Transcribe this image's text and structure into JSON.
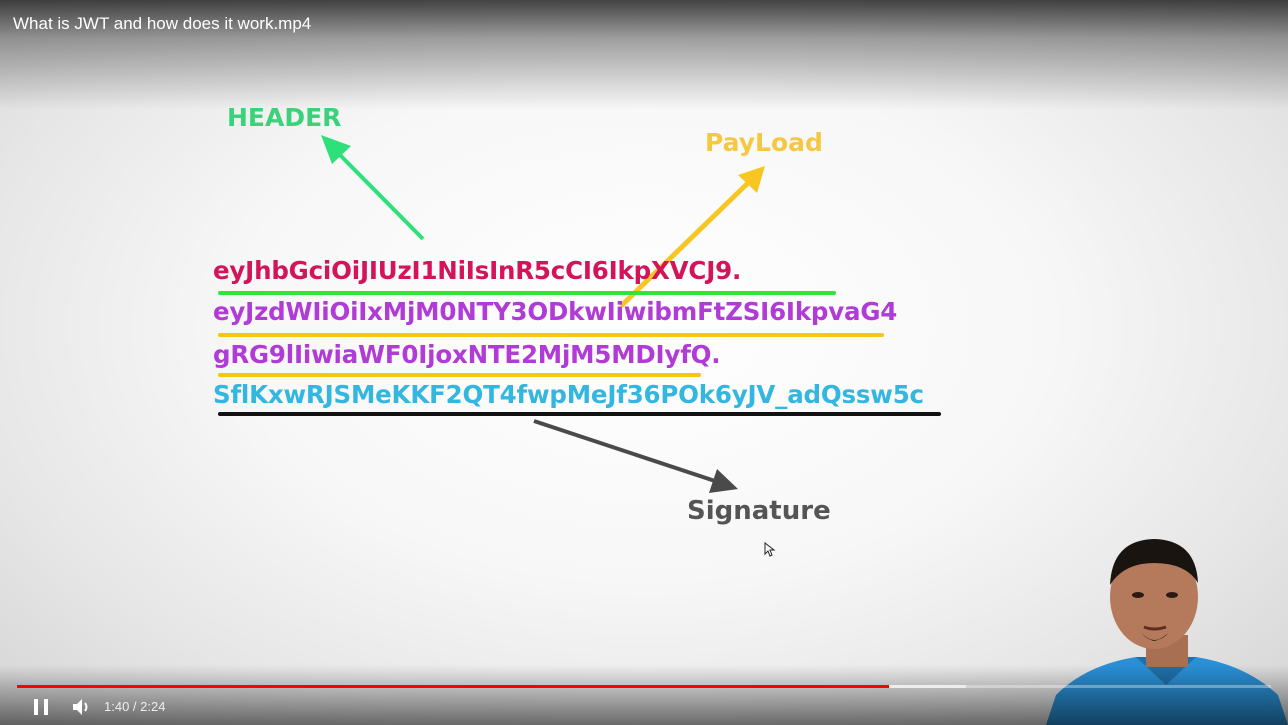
{
  "video": {
    "title": "What is JWT and how does it work.mp4"
  },
  "slide": {
    "header_label": "HEADER",
    "payload_label": "PayLoad",
    "signature_label": "Signature",
    "jwt_lines": [
      "eyJhbGciOiJIUzI1NiIsInR5cCI6IkpXVCJ9.",
      "eyJzdWIiOiIxMjM0NTY3ODkwIiwibmFtZSI6IkpvaG4",
      "gRG9lIiwiaWF0IjoxNTE2MjM5MDIyfQ.",
      "SflKxwRJSMeKKF2QT4fwpMeJf36POk6yJV_adQssw5c"
    ],
    "colors": {
      "header": "#3cd17a",
      "payload": "#f5c842",
      "signature": "#555555",
      "jwt_header": "#d4145a",
      "jwt_payload": "#b13bd6",
      "jwt_signature": "#33b6e0"
    }
  },
  "controls": {
    "current_time": "1:40",
    "separator": " / ",
    "duration": "2:24",
    "progress_fraction": 0.695,
    "buffered_fraction": 0.757,
    "icons": [
      "pause-icon",
      "volume-icon"
    ],
    "accent_color": "#ff0000"
  }
}
